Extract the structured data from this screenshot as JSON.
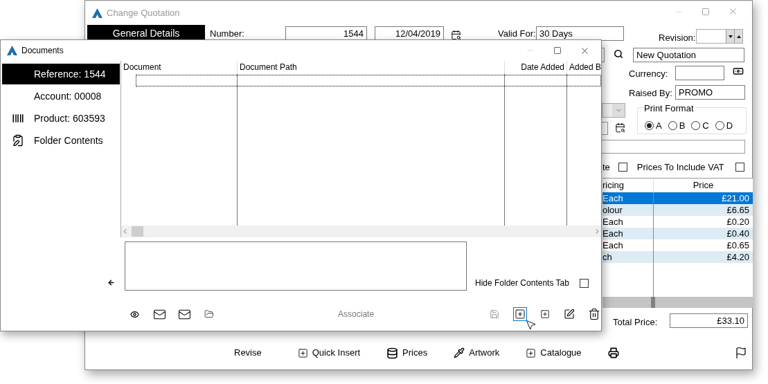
{
  "quotation_window": {
    "title": "Change Quotation",
    "tab": {
      "label": "General Details",
      "selected": true
    },
    "number": {
      "label": "Number:",
      "value": "1544",
      "date": "12/04/2019"
    },
    "valid_for": {
      "label": "Valid For:",
      "value": "30 Days"
    },
    "revision": {
      "label": "Revision:"
    },
    "description": "New Quotation",
    "currency": {
      "label": "Currency:"
    },
    "raised_by": {
      "label": "Raised By:",
      "value": "PROMO"
    },
    "print_format": {
      "label": "Print Format",
      "options": [
        {
          "label": "A",
          "selected": true
        },
        {
          "label": "B",
          "selected": false
        },
        {
          "label": "C",
          "selected": false
        },
        {
          "label": "D",
          "selected": false
        }
      ]
    },
    "checkboxes": [
      {
        "label": "te",
        "checked": false
      },
      {
        "label": "Prices To Include VAT",
        "checked": false
      }
    ],
    "pricing_table": {
      "columns": [
        "ricing",
        "Price"
      ],
      "rows": [
        {
          "pricing": "Each",
          "price": "£21.00",
          "selected": true
        },
        {
          "pricing": "olour",
          "price": "£6.65",
          "selected": false
        },
        {
          "pricing": "Each",
          "price": "£0.20",
          "selected": false
        },
        {
          "pricing": "Each",
          "price": "£0.40",
          "selected": false
        },
        {
          "pricing": "Each",
          "price": "£0.65",
          "selected": false
        },
        {
          "pricing": "ch",
          "price": "£4.20",
          "selected": false
        }
      ]
    },
    "total": {
      "label": "Total Price:",
      "value": "£33.10"
    },
    "toolbar": [
      {
        "kind": "text",
        "label": "Revise"
      },
      {
        "kind": "plus",
        "label": "Quick Insert"
      },
      {
        "kind": "database",
        "label": "Prices"
      },
      {
        "kind": "pipette",
        "label": "Artwork"
      },
      {
        "kind": "plus",
        "label": "Catalogue"
      },
      {
        "kind": "printer"
      }
    ]
  },
  "documents_window": {
    "title": "Documents",
    "sidebar": [
      {
        "kind": "none",
        "label": "Reference: 1544",
        "selected": true
      },
      {
        "kind": "none",
        "label": "Account: 00008",
        "selected": false
      },
      {
        "kind": "barcode",
        "label": "Product: 603593",
        "selected": false
      },
      {
        "kind": "clipboard",
        "label": "Folder Contents",
        "selected": false
      }
    ],
    "grid": {
      "columns": [
        "Document",
        "Document Path",
        "Date Added",
        "Added B"
      ]
    },
    "hide_folder_tab": {
      "label": "Hide Folder Contents Tab",
      "checked": false
    },
    "toolbar": [
      {
        "kind": "eye"
      },
      {
        "kind": "mail"
      },
      {
        "kind": "mail"
      },
      {
        "kind": "folder"
      },
      {
        "kind": "text",
        "label": "Associate",
        "disabled": true
      },
      {
        "kind": "save",
        "disabled": true
      },
      {
        "kind": "add",
        "focused": true
      },
      {
        "kind": "add",
        "focused": false
      },
      {
        "kind": "edit"
      },
      {
        "kind": "trash"
      }
    ]
  }
}
